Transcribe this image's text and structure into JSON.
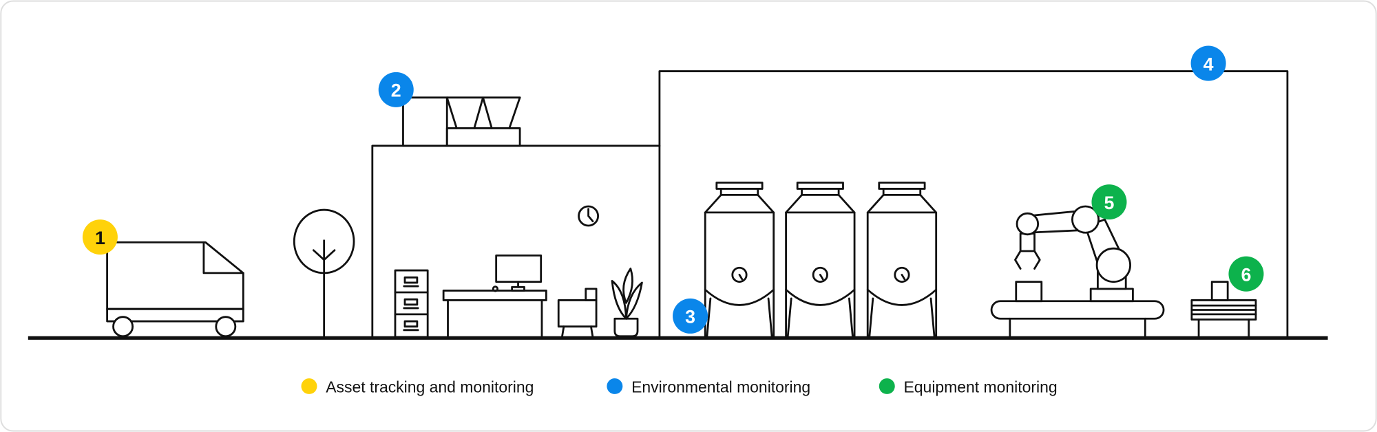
{
  "colors": {
    "asset": "#FFD20A",
    "environmental": "#0A86EA",
    "equipment": "#0DB24C",
    "line": "#111111",
    "border": "#DDDDDD"
  },
  "badges": [
    {
      "number": "1",
      "category": "asset"
    },
    {
      "number": "2",
      "category": "environmental"
    },
    {
      "number": "3",
      "category": "environmental"
    },
    {
      "number": "4",
      "category": "environmental"
    },
    {
      "number": "5",
      "category": "equipment"
    },
    {
      "number": "6",
      "category": "equipment"
    }
  ],
  "legend": [
    {
      "label": "Asset tracking and monitoring",
      "category": "asset"
    },
    {
      "label": "Environmental monitoring",
      "category": "environmental"
    },
    {
      "label": "Equipment monitoring",
      "category": "equipment"
    }
  ]
}
